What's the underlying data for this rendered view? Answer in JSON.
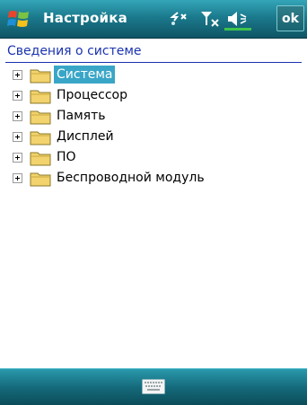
{
  "window": {
    "title": "Настройка",
    "ok_label": "ok"
  },
  "status_icons": [
    "connectivity-icon",
    "signal-off-icon",
    "volume-off-icon"
  ],
  "page": {
    "title": "Сведения о системе"
  },
  "tree": {
    "selected_index": 0,
    "items": [
      {
        "label": "Система"
      },
      {
        "label": "Процессор"
      },
      {
        "label": "Память"
      },
      {
        "label": "Дисплей"
      },
      {
        "label": "ПО"
      },
      {
        "label": "Беспроводной модуль"
      }
    ]
  },
  "bottombar": {
    "icon": "keyboard-icon"
  },
  "colors": {
    "titlebar": "#1b7a8d",
    "accent_text": "#1a33b0",
    "selection": "#3aa6c7"
  }
}
